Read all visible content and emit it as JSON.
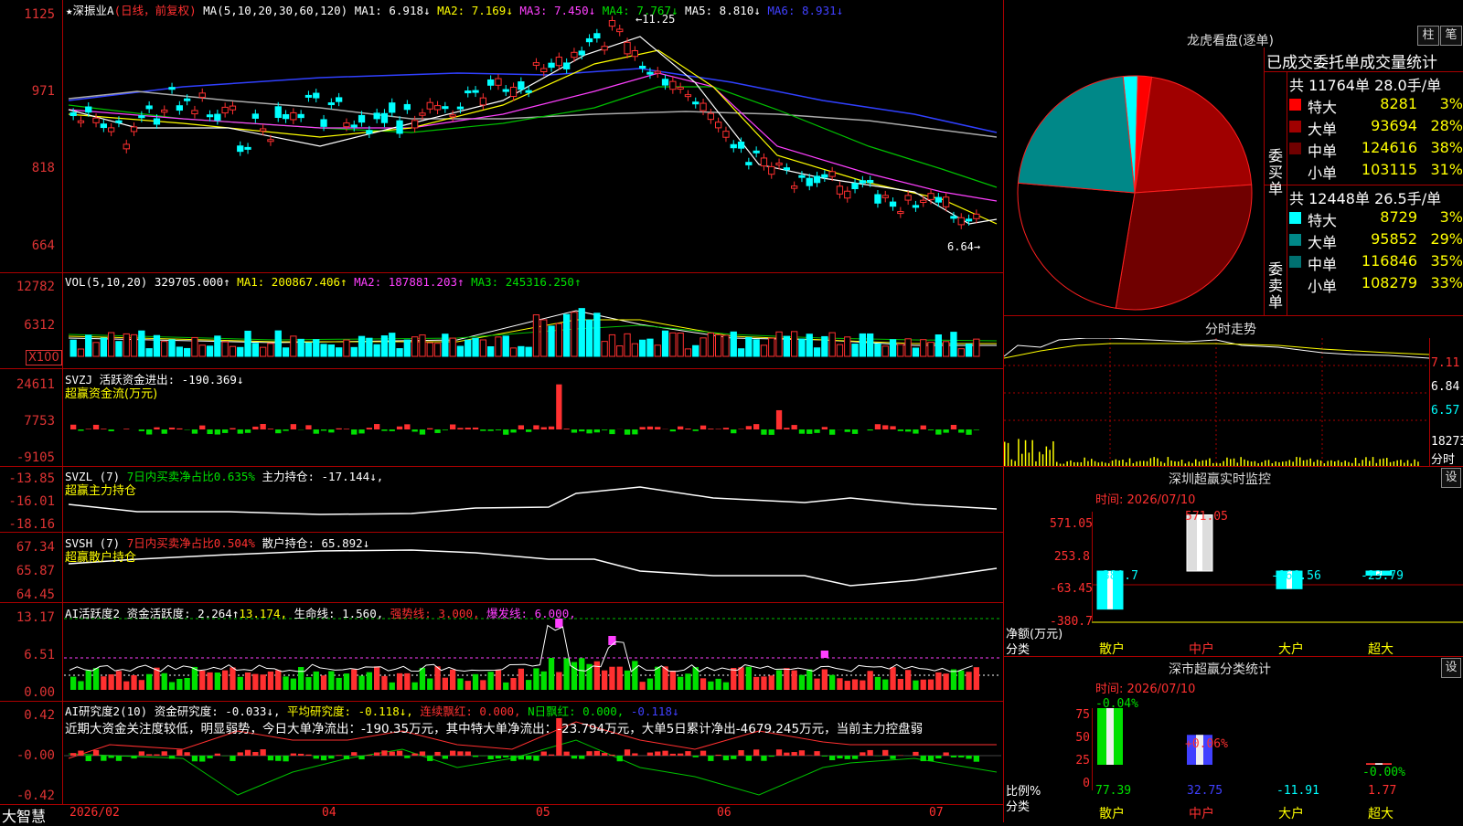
{
  "colors": {
    "up": "#ff3030",
    "down": "#00ffff",
    "grid": "#a00000",
    "ma1": "#ffffff",
    "ma2": "#ffff00",
    "ma3": "#ff40ff",
    "ma4": "#00d000",
    "ma5": "#aaaaaa",
    "ma6": "#3040ff"
  },
  "main": {
    "title": "★深振业A",
    "period": "(日线，前复权)",
    "ma_prefix": "MA(5,10,20,30,60,120)",
    "ma1": "MA1: 6.918↓",
    "ma2": "MA2: 7.169↓",
    "ma3": "MA3: 7.450↓",
    "ma4": "MA4: 7.767↓",
    "ma5": "MA5: 8.810↓",
    "ma6": "MA6: 8.931↓",
    "high_label": "←11.25",
    "low_label": "6.64→",
    "yticks": [
      "1125",
      "971",
      "818",
      "664"
    ]
  },
  "vol": {
    "title": "VOL(5,10,20)",
    "v": "329705.000↑",
    "ma1": "MA1: 200867.406↑",
    "ma2": "MA2: 187881.203↑",
    "ma3": "MA3: 245316.250↑",
    "yticks": [
      "12782",
      "6312"
    ],
    "unit": "X100"
  },
  "svzj": {
    "title": "SVZJ  活跃资金进出: -190.369↓",
    "sub": "超赢资金流(万元)",
    "yticks": [
      "24611",
      "7753",
      "-9105"
    ]
  },
  "svzl": {
    "title": "SVZL (7)",
    "t1": "7日内买卖净占比0.635%",
    "t2": "主力持仓: -17.144↓,",
    "sub": "超赢主力持仓",
    "yticks": [
      "-13.85",
      "-16.01",
      "-18.16"
    ]
  },
  "svsh": {
    "title": "SVSH (7)",
    "t1": "7日内买卖净占比0.504%",
    "t2": "散户持仓: 65.892↓",
    "sub": "超赢散户持仓",
    "yticks": [
      "67.34",
      "65.87",
      "64.45"
    ]
  },
  "ai1": {
    "title": "AI活跃度2",
    "t1": "资金活跃度: 2.264↑",
    "t2": "13.174,",
    "t3": "生命线: 1.560,",
    "t4": "强势线: 3.000,",
    "t5": "爆发线: 6.000,",
    "yticks": [
      "13.17",
      "6.51",
      "0.00"
    ]
  },
  "ai2": {
    "title": "AI研究度2(10)",
    "t1": "资金研究度: -0.033↓,",
    "t2": "平均研究度: -0.118↓,",
    "t3": "连续飘红: 0.000,",
    "t4": "N日飘红: 0.000,",
    "t5": "-0.118↓",
    "note": "近期大资金关注度较低，明显弱势，今日大单净流出：-190.35万元，其中特大单净流出：-23.794万元，大单5日累计净出-4679.245万元，当前主力控盘弱",
    "yticks": [
      "0.42",
      "-0.00",
      "-0.42"
    ]
  },
  "bottom": {
    "brand": "大智慧",
    "dates": [
      "2026/02",
      "04",
      "05",
      "06",
      "07"
    ]
  },
  "right": {
    "pie_title": "龙虎看盘(逐单)",
    "btn1": "柱",
    "btn2": "笔",
    "stat_title": "已成交委托单成交量统计",
    "buy_label": "委买单",
    "sell_label": "委卖单",
    "buy_head": "共 11764单 28.0手/单",
    "sell_head": "共 12448单 26.5手/单",
    "buy_rows": [
      {
        "name": "特大",
        "v": "8281",
        "p": "3%",
        "c": "#ff0000"
      },
      {
        "name": "大单",
        "v": "93694",
        "p": "28%",
        "c": "#a00000"
      },
      {
        "name": "中单",
        "v": "124616",
        "p": "38%",
        "c": "#700000"
      },
      {
        "name": "小单",
        "v": "103115",
        "p": "31%",
        "c": "#000000"
      }
    ],
    "sell_rows": [
      {
        "name": "特大",
        "v": "8729",
        "p": "3%",
        "c": "#00ffff"
      },
      {
        "name": "大单",
        "v": "95852",
        "p": "29%",
        "c": "#008888"
      },
      {
        "name": "中单",
        "v": "116846",
        "p": "35%",
        "c": "#007070"
      },
      {
        "name": "小单",
        "v": "108279",
        "p": "33%",
        "c": "#000000"
      }
    ],
    "intraday_title": "分时走势",
    "intraday_y": [
      "7.11",
      "6.84",
      "6.57",
      "18273",
      "分时"
    ],
    "monitor_title": "深圳超赢实时监控",
    "set_btn": "设",
    "monitor_time": "时间: 2026/07/10",
    "monitor_y": [
      "571.05",
      "253.8",
      "-63.45",
      "-380.7"
    ],
    "monitor_vals": [
      "-380.7",
      "571.05",
      "-166.56",
      "-23.79"
    ],
    "monitor_axis": "净额(万元)",
    "class_label": "分类",
    "categories": [
      "散户",
      "中户",
      "大户",
      "超大"
    ],
    "stats_title": "深市超赢分类统计",
    "stats_time": "时间: 2026/07/10",
    "stats_y": [
      "75",
      "50",
      "25",
      "0"
    ],
    "stats_top": [
      "-0.04%",
      "+0.06%",
      "-0.00%"
    ],
    "stats_axis": "比例%",
    "stats_vals": [
      "77.39",
      "32.75",
      "-11.91",
      "1.77"
    ]
  }
}
